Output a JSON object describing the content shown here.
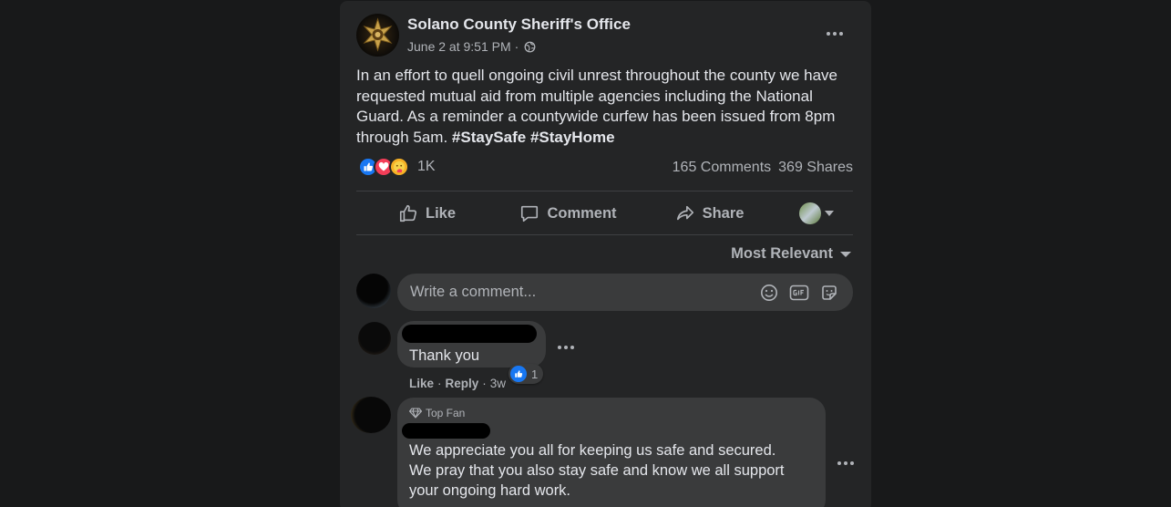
{
  "post": {
    "page_name": "Solano County Sheriff's Office",
    "timestamp": "June 2 at 9:51 PM",
    "separator": "·",
    "privacy_icon": "globe-icon",
    "text": "In an effort to quell ongoing civil unrest throughout the county we have requested mutual aid from multiple agencies including the National Guard. As a reminder a countywide curfew has been issued from 8pm through 5am.",
    "hashtags": [
      "#StaySafe",
      "#StayHome"
    ],
    "reaction_icons": [
      "like-icon",
      "love-icon",
      "care-icon"
    ],
    "reaction_count": "1K",
    "comments_count": "165 Comments",
    "shares_count": "369 Shares"
  },
  "actions": {
    "like": "Like",
    "comment": "Comment",
    "share": "Share"
  },
  "comments_section": {
    "sort_label": "Most Relevant",
    "composer_placeholder": "Write a comment...",
    "composer_icons": [
      "emoji-icon",
      "gif-icon",
      "sticker-icon"
    ]
  },
  "comments": [
    {
      "text": "Thank you",
      "like_label": "Like",
      "reply_label": "Reply",
      "sep": "·",
      "age": "3w",
      "reaction_count": "1"
    },
    {
      "badge": "Top Fan",
      "lines": [
        "We appreciate you all for keeping us safe and secured.",
        "We pray that you also stay safe and know we all support",
        "your ongoing hard work."
      ]
    }
  ],
  "colors": {
    "background": "#18191a",
    "card": "#242526",
    "bubble": "#3a3b3c",
    "primary_text": "#e4e6eb",
    "secondary_text": "#b0b3b8",
    "like_blue": "#1877f2",
    "love_red": "#f33e58",
    "care_yellow": "#f7b125"
  }
}
